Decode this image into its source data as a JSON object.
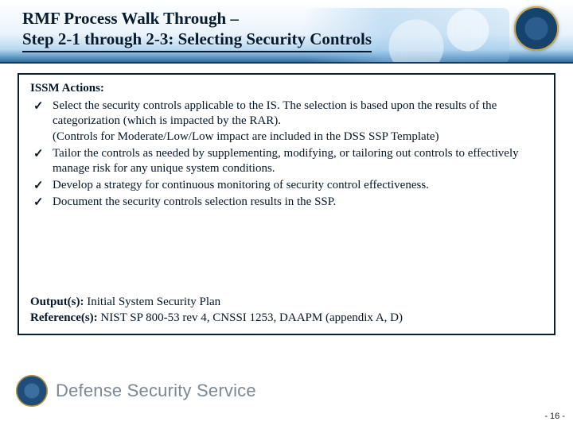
{
  "header": {
    "title_line1": "RMF Process Walk Through –",
    "title_line2": "Step 2-1 through 2-3:  Selecting Security Controls"
  },
  "content": {
    "actions_label": "ISSM Actions:",
    "actions": [
      "Select the security controls applicable to the IS.  The selection is based upon the results of the categorization (which is impacted by the RAR).\n(Controls for Moderate/Low/Low impact are included in the DSS SSP Template)",
      "Tailor the controls as needed by supplementing, modifying, or tailoring out controls to effectively manage risk for any unique system conditions.",
      "Develop a strategy for continuous monitoring of security control effectiveness.",
      "Document the security controls selection results in the SSP."
    ],
    "outputs_label": "Output(s):",
    "outputs_value": " Initial System Security Plan",
    "references_label": "Reference(s):",
    "references_value": " NIST SP 800-53 rev 4, CNSSI 1253, DAAPM (appendix A, D)"
  },
  "footer": {
    "org": "Defense Security Service",
    "page": "- 16 -"
  }
}
